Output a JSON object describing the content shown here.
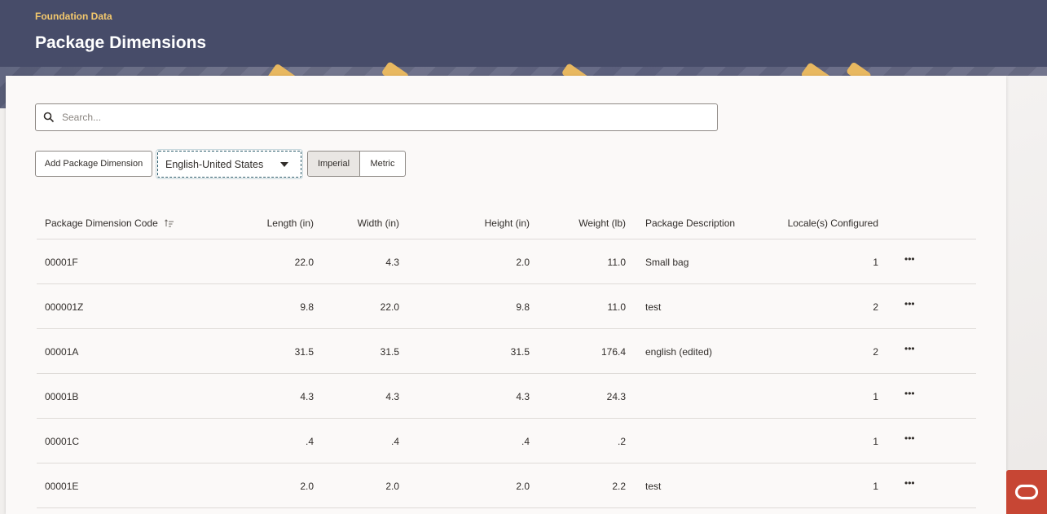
{
  "header": {
    "breadcrumb": "Foundation Data",
    "title": "Package Dimensions"
  },
  "search": {
    "placeholder": "Search...",
    "value": ""
  },
  "toolbar": {
    "add_label": "Add Package Dimension",
    "locale_selected": "English-United States",
    "units": [
      "Imperial",
      "Metric"
    ],
    "units_selected": "Imperial"
  },
  "table": {
    "columns": [
      "Package Dimension Code",
      "Length (in)",
      "Width (in)",
      "Height (in)",
      "Weight (lb)",
      "Package Description",
      "Locale(s) Configured"
    ],
    "rows": [
      {
        "code": "00001F",
        "length": "22.0",
        "width": "4.3",
        "height": "2.0",
        "weight": "11.0",
        "description": "Small bag",
        "locales": "1"
      },
      {
        "code": "000001Z",
        "length": "9.8",
        "width": "22.0",
        "height": "9.8",
        "weight": "11.0",
        "description": "test",
        "locales": "2"
      },
      {
        "code": "00001A",
        "length": "31.5",
        "width": "31.5",
        "height": "31.5",
        "weight": "176.4",
        "description": "english (edited)",
        "locales": "2"
      },
      {
        "code": "00001B",
        "length": "4.3",
        "width": "4.3",
        "height": "4.3",
        "weight": "24.3",
        "description": "",
        "locales": "1"
      },
      {
        "code": "00001C",
        "length": ".4",
        "width": ".4",
        "height": ".4",
        "weight": ".2",
        "description": "",
        "locales": "1"
      },
      {
        "code": "00001E",
        "length": "2.0",
        "width": "2.0",
        "height": "2.0",
        "weight": "2.2",
        "description": "test",
        "locales": "1"
      }
    ],
    "more_label": "•••"
  },
  "icons": {
    "search": "search-icon",
    "sort": "sort-ascending-icon",
    "dropdown": "caret-down-icon",
    "more": "more-horizontal-icon",
    "brand": "oracle-logo-icon"
  },
  "colors": {
    "header_bg": "#474c69",
    "breadcrumb": "#f3c86d",
    "brand_badge": "#c74634"
  }
}
